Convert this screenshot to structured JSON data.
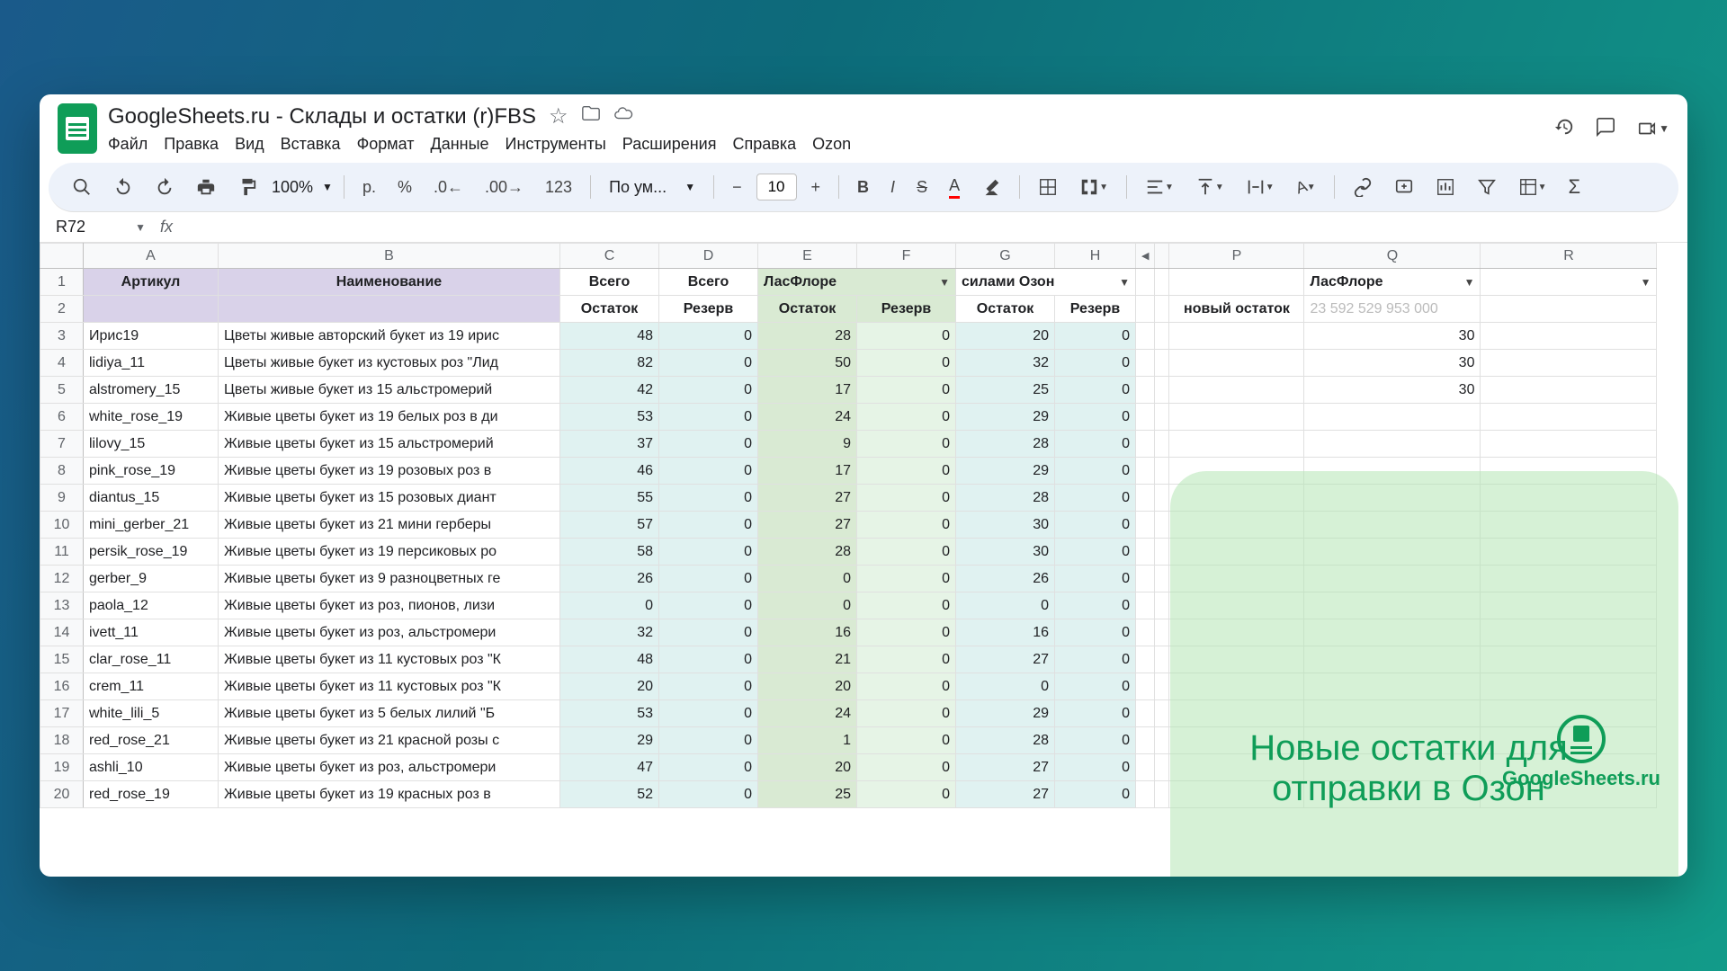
{
  "doc_title": "GoogleSheets.ru - Склады и остатки (r)FBS",
  "menu": {
    "file": "Файл",
    "edit": "Правка",
    "view": "Вид",
    "insert": "Вставка",
    "format": "Формат",
    "data": "Данные",
    "tools": "Инструменты",
    "extensions": "Расширения",
    "help": "Справка",
    "ozon": "Ozon"
  },
  "toolbar": {
    "zoom": "100%",
    "currency": "р.",
    "percent": "%",
    "font": "По ум...",
    "font_size": "10"
  },
  "name_box": "R72",
  "columns": [
    "A",
    "B",
    "C",
    "D",
    "E",
    "F",
    "G",
    "H",
    "P",
    "Q",
    "R"
  ],
  "headers": {
    "row1": {
      "A": "Артикул",
      "B": "Наименование",
      "C": "Всего",
      "D": "Всего",
      "EF": "ЛасФлоре",
      "GH": "силами Озон",
      "Q": "ЛасФлоре"
    },
    "row2": {
      "C": "Остаток",
      "D": "Резерв",
      "E": "Остаток",
      "F": "Резерв",
      "G": "Остаток",
      "H": "Резерв",
      "P": "новый остаток",
      "Q": "23 592 529 953 000"
    }
  },
  "rows": [
    {
      "n": 3,
      "a": "Ирис19",
      "b": "Цветы живые авторский букет из 19 ирис",
      "c": 48,
      "d": 0,
      "e": 28,
      "f": 0,
      "g": 20,
      "h": 0,
      "q": 30
    },
    {
      "n": 4,
      "a": "lidiya_11",
      "b": "Цветы живые букет из кустовых роз \"Лид",
      "c": 82,
      "d": 0,
      "e": 50,
      "f": 0,
      "g": 32,
      "h": 0,
      "q": 30
    },
    {
      "n": 5,
      "a": "alstromery_15",
      "b": "Цветы живые букет из 15 альстромерий",
      "c": 42,
      "d": 0,
      "e": 17,
      "f": 0,
      "g": 25,
      "h": 0,
      "q": 30
    },
    {
      "n": 6,
      "a": "white_rose_19",
      "b": "Живые цветы букет из 19 белых роз в ди",
      "c": 53,
      "d": 0,
      "e": 24,
      "f": 0,
      "g": 29,
      "h": 0
    },
    {
      "n": 7,
      "a": "lilovy_15",
      "b": "Живые цветы букет из 15 альстромерий",
      "c": 37,
      "d": 0,
      "e": 9,
      "f": 0,
      "g": 28,
      "h": 0
    },
    {
      "n": 8,
      "a": "pink_rose_19",
      "b": "Живые цветы букет из 19 розовых роз в",
      "c": 46,
      "d": 0,
      "e": 17,
      "f": 0,
      "g": 29,
      "h": 0
    },
    {
      "n": 9,
      "a": "diantus_15",
      "b": "Живые цветы букет из 15 розовых диант",
      "c": 55,
      "d": 0,
      "e": 27,
      "f": 0,
      "g": 28,
      "h": 0
    },
    {
      "n": 10,
      "a": "mini_gerber_21",
      "b": "Живые цветы букет из 21 мини герберы",
      "c": 57,
      "d": 0,
      "e": 27,
      "f": 0,
      "g": 30,
      "h": 0
    },
    {
      "n": 11,
      "a": "persik_rose_19",
      "b": "Живые цветы букет из 19 персиковых ро",
      "c": 58,
      "d": 0,
      "e": 28,
      "f": 0,
      "g": 30,
      "h": 0
    },
    {
      "n": 12,
      "a": "gerber_9",
      "b": "Живые цветы букет из 9 разноцветных ге",
      "c": 26,
      "d": 0,
      "e": 0,
      "f": 0,
      "g": 26,
      "h": 0
    },
    {
      "n": 13,
      "a": "paola_12",
      "b": "Живые цветы букет из роз, пионов, лизи",
      "c": 0,
      "d": 0,
      "e": 0,
      "f": 0,
      "g": 0,
      "h": 0
    },
    {
      "n": 14,
      "a": "ivett_11",
      "b": "Живые цветы букет из роз, альстромери",
      "c": 32,
      "d": 0,
      "e": 16,
      "f": 0,
      "g": 16,
      "h": 0
    },
    {
      "n": 15,
      "a": "clar_rose_11",
      "b": "Живые цветы букет из 11 кустовых роз \"К",
      "c": 48,
      "d": 0,
      "e": 21,
      "f": 0,
      "g": 27,
      "h": 0
    },
    {
      "n": 16,
      "a": "crem_11",
      "b": "Живые цветы букет из 11 кустовых роз \"К",
      "c": 20,
      "d": 0,
      "e": 20,
      "f": 0,
      "g": 0,
      "h": 0
    },
    {
      "n": 17,
      "a": "white_lili_5",
      "b": "Живые цветы букет из 5 белых лилий \"Б",
      "c": 53,
      "d": 0,
      "e": 24,
      "f": 0,
      "g": 29,
      "h": 0
    },
    {
      "n": 18,
      "a": "red_rose_21",
      "b": "Живые цветы букет из 21 красной розы с",
      "c": 29,
      "d": 0,
      "e": 1,
      "f": 0,
      "g": 28,
      "h": 0
    },
    {
      "n": 19,
      "a": "ashli_10",
      "b": "Живые цветы букет из роз, альстромери",
      "c": 47,
      "d": 0,
      "e": 20,
      "f": 0,
      "g": 27,
      "h": 0
    },
    {
      "n": 20,
      "a": "red_rose_19",
      "b": "Живые цветы букет из 19 красных роз в",
      "c": 52,
      "d": 0,
      "e": 25,
      "f": 0,
      "g": 27,
      "h": 0
    }
  ],
  "annotation": "Новые остатки для отправки в Озон",
  "watermark": "GoogleSheets.ru"
}
